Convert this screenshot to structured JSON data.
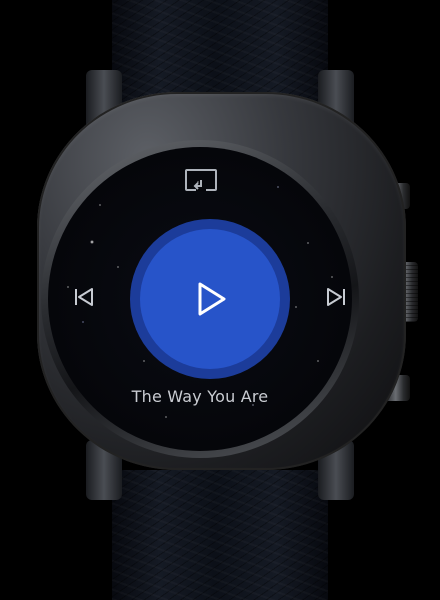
{
  "player": {
    "track_title": "The Way You Are",
    "accent_color": "#2754c9",
    "ring_color": "#1c3c9a"
  },
  "controls": {
    "cast": "cast-icon",
    "previous": "skip-previous-icon",
    "play": "play-icon",
    "next": "skip-next-icon"
  }
}
